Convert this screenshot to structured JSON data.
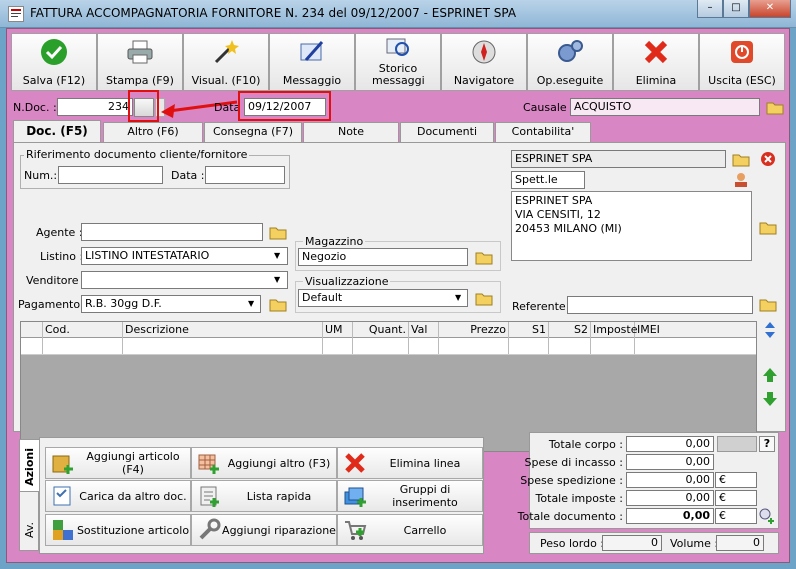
{
  "window": {
    "title": "FATTURA ACCOMPAGNATORIA FORNITORE N. 234  del 09/12/2007 - ESPRINET SPA",
    "min": "–",
    "max": "□",
    "close": "✕"
  },
  "toolbar": [
    {
      "label": "Salva (F12)",
      "icon": "save-check-icon"
    },
    {
      "label": "Stampa (F9)",
      "icon": "printer-icon"
    },
    {
      "label": "Visual. (F10)",
      "icon": "magic-wand-icon"
    },
    {
      "label": "Messaggio",
      "icon": "message-pen-icon"
    },
    {
      "label": "Storico messaggi",
      "icon": "message-history-icon"
    },
    {
      "label": "Navigatore",
      "icon": "compass-icon"
    },
    {
      "label": "Op.eseguite",
      "icon": "gears-icon"
    },
    {
      "label": "Elimina",
      "icon": "delete-x-icon"
    },
    {
      "label": "Uscita (ESC)",
      "icon": "exit-icon"
    }
  ],
  "header": {
    "ndoc_label": "N.Doc. :",
    "ndoc_value": "234",
    "data_label": "Data",
    "data_value": "09/12/2007",
    "causale_label": "Causale :",
    "causale_value": "ACQUISTO"
  },
  "tabs": [
    "Doc. (F5)",
    "Altro (F6)",
    "Consegna (F7)",
    "Note",
    "Documenti",
    "Contabilita'"
  ],
  "riferimento": {
    "title": "Riferimento documento cliente/fornitore",
    "num_label": "Num.:",
    "num_value": "",
    "data_label": "Data :",
    "data_value": ""
  },
  "fields": {
    "agente_label": "Agente :",
    "agente_value": "",
    "listino_label": "Listino :",
    "listino_value": "LISTINO INTESTATARIO",
    "venditore_label": "Venditore :",
    "venditore_value": "",
    "pagamento_label": "Pagamento :",
    "pagamento_value": "R.B. 30gg D.F.",
    "magazzino_title": "Magazzino",
    "magazzino_value": "Negozio",
    "visualizzazione_title": "Visualizzazione",
    "visualizzazione_value": "Default"
  },
  "cliente": {
    "name": "ESPRINET SPA",
    "prefix": "Spett.le",
    "address": [
      "ESPRINET SPA",
      "VIA CENSITI, 12",
      "20453 MILANO (MI)"
    ],
    "referente_label": "Referente",
    "referente_value": ""
  },
  "grid": {
    "columns": [
      "Cod.",
      "Descrizione",
      "UM",
      "Quant.",
      "Val",
      "Prezzo",
      "S1",
      "S2",
      "Imposte",
      "IMEI"
    ]
  },
  "side_tabs": [
    "Azioni",
    "Av."
  ],
  "actions": [
    {
      "label": "Aggiungi articolo (F4)",
      "icon": "add-box-icon"
    },
    {
      "label": "Aggiungi altro (F3)",
      "icon": "add-grid-icon"
    },
    {
      "label": "Elimina linea",
      "icon": "delete-line-icon"
    },
    {
      "label": "Carica da altro doc.",
      "icon": "load-doc-icon"
    },
    {
      "label": "Lista rapida",
      "icon": "quick-list-icon"
    },
    {
      "label": "Gruppi di inserimento",
      "icon": "groups-icon"
    },
    {
      "label": "Sostituzione articolo",
      "icon": "replace-icon"
    },
    {
      "label": "Aggiungi riparazione",
      "icon": "wrench-icon"
    },
    {
      "label": "Carrello",
      "icon": "cart-icon"
    }
  ],
  "totals": [
    {
      "label": "Totale corpo :",
      "value": "0,00",
      "unit": ""
    },
    {
      "label": "Spese di incasso :",
      "value": "0,00",
      "unit": ""
    },
    {
      "label": "Spese spedizione :",
      "value": "0,00",
      "unit": "€"
    },
    {
      "label": "Totale imposte :",
      "value": "0,00",
      "unit": "€"
    },
    {
      "label": "Totale documento :",
      "value": "0,00",
      "unit": "€"
    }
  ],
  "help": "?",
  "weights": {
    "peso_label": "Peso lordo :",
    "peso_value": "0",
    "volume_label": "Volume :",
    "volume_value": "0"
  },
  "colors": {
    "client_bg": "#d887c4",
    "panel_bg": "#f0f0f0",
    "annotation_red": "#e01010"
  }
}
